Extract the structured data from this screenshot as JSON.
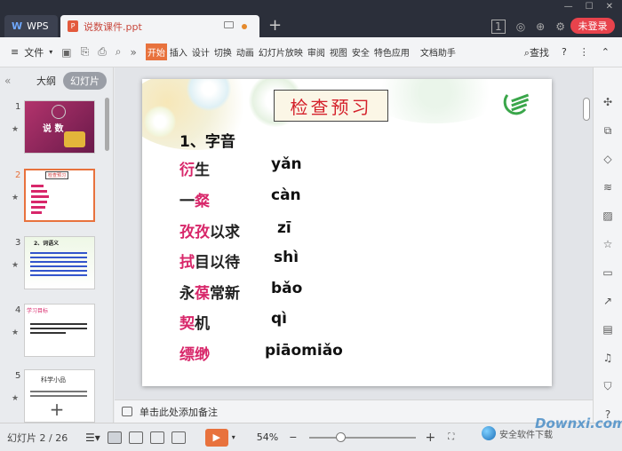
{
  "titlebar": {
    "app_tab": "WPS",
    "doc_tab": "说数课件.ppt",
    "badge_num": "1",
    "login": "未登录"
  },
  "toolbar": {
    "file": "文件",
    "tabs": [
      "开始",
      "插入",
      "设计",
      "切换",
      "动画",
      "幻灯片放映",
      "审阅",
      "视图",
      "安全",
      "特色应用",
      "文档助手"
    ],
    "search": "查找",
    "help": "?"
  },
  "sidebar": {
    "outline_tab": "大纲",
    "slides_tab": "幻灯片",
    "thumbs": [
      {
        "num": "1",
        "label": "说 数"
      },
      {
        "num": "2",
        "label": "检查预习"
      },
      {
        "num": "3",
        "label": "2、词语义"
      },
      {
        "num": "4",
        "label": "学习目标"
      },
      {
        "num": "5",
        "label": "科学小品"
      }
    ]
  },
  "slide": {
    "title": "检查预习",
    "section": "1、字音",
    "rows": [
      {
        "pink": "衍",
        "rest": "生",
        "pinyin": "yǎn"
      },
      {
        "pre": "一",
        "pink": "粲",
        "rest": "",
        "pinyin": "càn"
      },
      {
        "pink": "孜孜",
        "rest": "以求",
        "pinyin": "zī"
      },
      {
        "pink": "拭",
        "rest": "目以待",
        "pinyin": "shì"
      },
      {
        "pre": "永",
        "pink": "葆",
        "rest": "常新",
        "pinyin": "bǎo"
      },
      {
        "pink": "契",
        "rest": "机",
        "pinyin": "qì"
      },
      {
        "pink": "缥缈",
        "rest": "",
        "pinyin": "piāomiǎo"
      }
    ]
  },
  "notes": {
    "placeholder": "单击此处添加备注"
  },
  "statusbar": {
    "slide_info": "幻灯片 2 / 26",
    "zoom": "54%",
    "zoom_level": 0.54
  },
  "watermark": {
    "text": "安全软件下载",
    "logo": "Downxi.com"
  }
}
